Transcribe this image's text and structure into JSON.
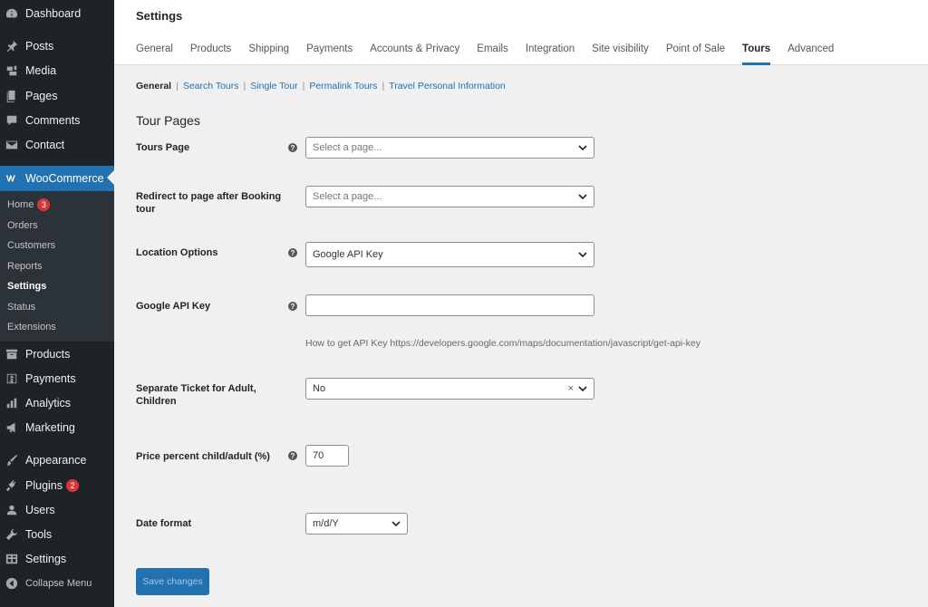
{
  "sidebar": {
    "items": [
      {
        "label": "Dashboard",
        "icon": "dashboard-icon"
      },
      {
        "label": "Posts",
        "icon": "pin-icon"
      },
      {
        "label": "Media",
        "icon": "media-icon"
      },
      {
        "label": "Pages",
        "icon": "pages-icon"
      },
      {
        "label": "Comments",
        "icon": "comment-icon"
      },
      {
        "label": "Contact",
        "icon": "mail-icon"
      },
      {
        "label": "WooCommerce",
        "icon": "woo-icon"
      },
      {
        "label": "Products",
        "icon": "archive-icon"
      },
      {
        "label": "Payments",
        "icon": "dollar-icon"
      },
      {
        "label": "Analytics",
        "icon": "chart-icon"
      },
      {
        "label": "Marketing",
        "icon": "megaphone-icon"
      },
      {
        "label": "Appearance",
        "icon": "brush-icon"
      },
      {
        "label": "Plugins",
        "icon": "plugin-icon",
        "badge": "2"
      },
      {
        "label": "Users",
        "icon": "user-icon"
      },
      {
        "label": "Tools",
        "icon": "wrench-icon"
      },
      {
        "label": "Settings",
        "icon": "settings-icon"
      },
      {
        "label": "Collapse Menu",
        "icon": "collapse-icon"
      }
    ],
    "submenu": [
      {
        "label": "Home",
        "badge": "3"
      },
      {
        "label": "Orders"
      },
      {
        "label": "Customers"
      },
      {
        "label": "Reports"
      },
      {
        "label": "Settings"
      },
      {
        "label": "Status"
      },
      {
        "label": "Extensions"
      }
    ]
  },
  "header": {
    "title": "Settings",
    "tabs": [
      "General",
      "Products",
      "Shipping",
      "Payments",
      "Accounts & Privacy",
      "Emails",
      "Integration",
      "Site visibility",
      "Point of Sale",
      "Tours",
      "Advanced"
    ],
    "active_tab": "Tours"
  },
  "subnav": {
    "links": [
      "General",
      "Search Tours",
      "Single Tour",
      "Permalink Tours",
      "Travel Personal Information"
    ],
    "separator": "|"
  },
  "section": {
    "title": "Tour Pages"
  },
  "fields": {
    "tours_page": {
      "label": "Tours Page",
      "placeholder": "Select a page..."
    },
    "redirect": {
      "label": "Redirect to page after Booking tour",
      "placeholder": "Select a page..."
    },
    "location": {
      "label": "Location Options",
      "value": "Google API Key"
    },
    "api_key": {
      "label": "Google API Key",
      "value": "",
      "description": "How to get API Key https://developers.google.com/maps/documentation/javascript/get-api-key"
    },
    "separate_ticket": {
      "label": "Separate Ticket for Adult, Children",
      "value": "No",
      "clear": "×"
    },
    "price_percent": {
      "label": "Price percent child/adult (%)",
      "value": "70"
    },
    "date_format": {
      "label": "Date format",
      "value": "m/d/Y"
    }
  },
  "help_glyph": "?",
  "save_label": "Save changes",
  "colors": {
    "accent": "#2271b1",
    "sidebar": "#1d2327",
    "badge": "#d63638"
  }
}
